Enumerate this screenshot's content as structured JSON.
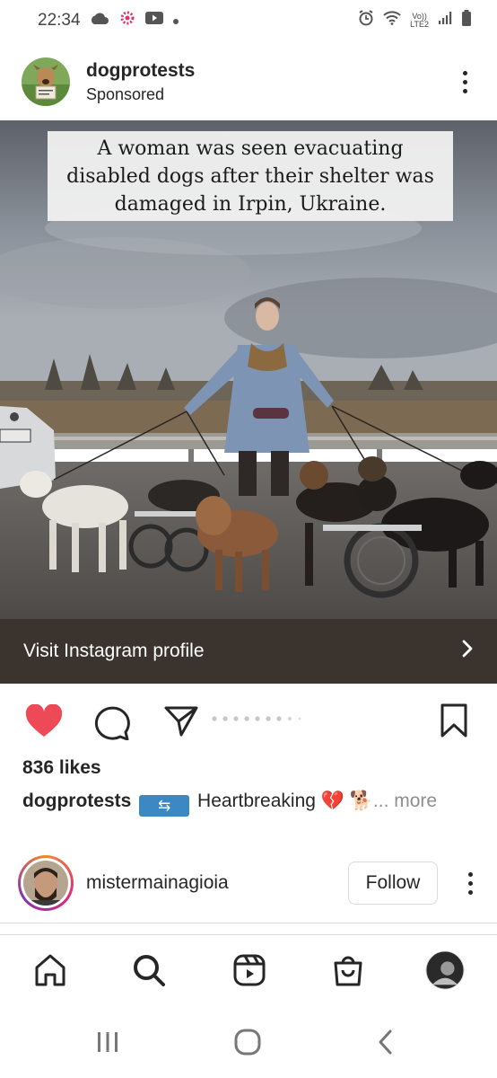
{
  "status_bar": {
    "time": "22:34",
    "network_label_top": "Vo))",
    "network_label_bottom": "LTE2"
  },
  "post": {
    "username": "dogprotests",
    "sponsored_label": "Sponsored",
    "image_caption": "A woman was seen evacuating disabled dogs after their shelter was damaged in Irpin, Ukraine.",
    "cta_label": "Visit Instagram profile",
    "likes": "836 likes",
    "caption_username": "dogprotests",
    "caption_text": "Heartbreaking",
    "caption_emojis": "💔 🐕",
    "more_label": "... more",
    "liked": true
  },
  "suggestion": {
    "username": "mistermainagioia",
    "follow_label": "Follow"
  },
  "colors": {
    "like_red": "#ed4956",
    "cta_bg": "#3a332e",
    "text": "#262626",
    "muted": "#8e8e8e"
  },
  "icons": {
    "status_left": [
      "cloud-icon",
      "instagram-notification-icon",
      "youtube-icon",
      "dot-icon"
    ],
    "status_right": [
      "alarm-icon",
      "wifi-icon",
      "signal-icon",
      "battery-icon"
    ],
    "actions": [
      "heart-filled-icon",
      "comment-icon",
      "share-icon",
      "bookmark-icon"
    ],
    "bottom_nav": [
      "home-icon",
      "search-icon",
      "reels-icon",
      "shop-icon",
      "profile-avatar"
    ],
    "system_nav": [
      "recents-icon",
      "home-circle-icon",
      "back-icon"
    ]
  }
}
